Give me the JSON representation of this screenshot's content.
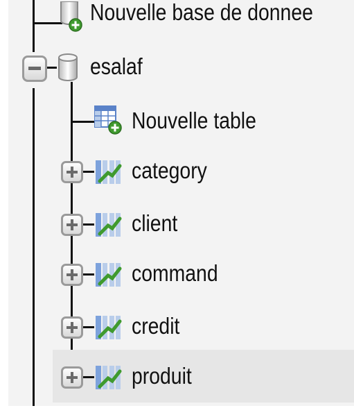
{
  "tree": {
    "new_database": {
      "label": "Nouvelle base de donnee",
      "icon": "database-add-icon"
    },
    "database": {
      "label": "esalaf",
      "expanded": true,
      "icon": "database-icon"
    },
    "new_table": {
      "label": "Nouvelle table",
      "icon": "table-add-icon"
    },
    "tables": [
      {
        "label": "category",
        "icon": "table-icon",
        "expanded": false
      },
      {
        "label": "client",
        "icon": "table-icon",
        "expanded": false
      },
      {
        "label": "command",
        "icon": "table-icon",
        "expanded": false
      },
      {
        "label": "credit",
        "icon": "table-icon",
        "expanded": false
      },
      {
        "label": "produit",
        "icon": "table-icon",
        "expanded": false,
        "highlighted": true
      }
    ]
  },
  "colors": {
    "panel_background": "#f3f3f3",
    "highlight_background": "#e6e6e6",
    "tree_line": "#111111",
    "icon_green": "#3f9a2e",
    "icon_blue": "#5a82c8"
  }
}
